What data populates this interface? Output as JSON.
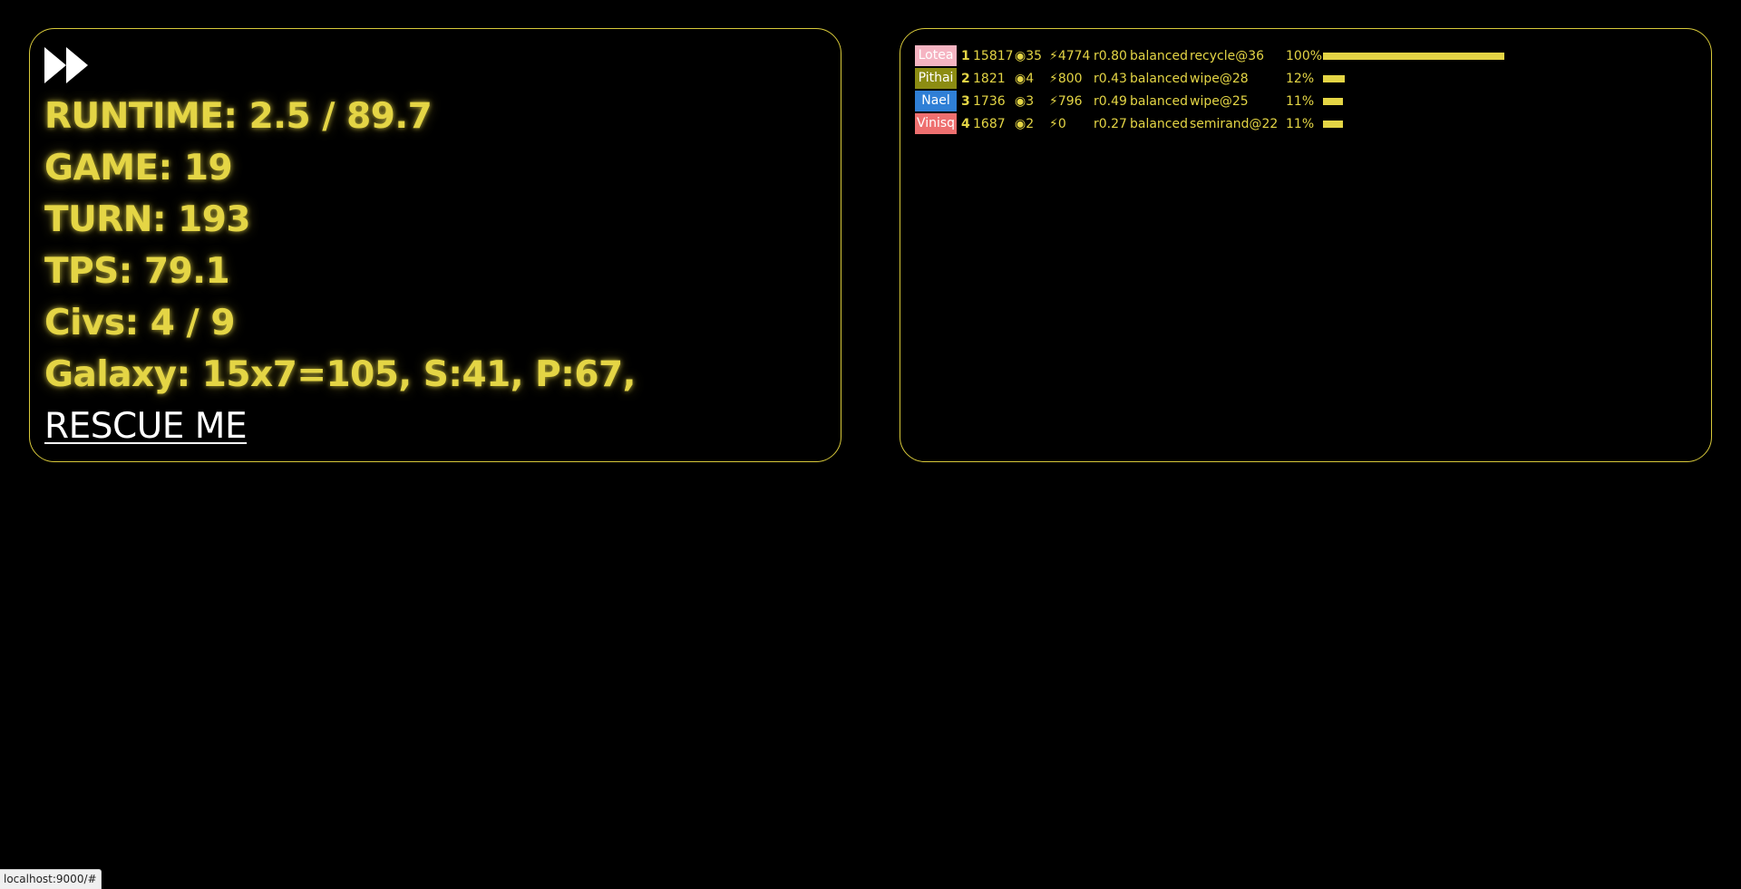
{
  "controls": {
    "fast_forward_icon": "fast-forward-icon"
  },
  "stats": {
    "runtime": "RUNTIME: 2.5 / 89.7",
    "game": "GAME: 19",
    "turn": "TURN: 193",
    "tps": "TPS: 79.1",
    "civs": "Civs: 4 / 9",
    "galaxy": "Galaxy: 15x7=105, S:41, P:67,",
    "rescue_label": "RESCUE ME"
  },
  "colors": {
    "accent": "#e4d545",
    "panel_border": "#d8c93a",
    "background": "#000000",
    "link": "#ffffff"
  },
  "rankings": [
    {
      "name": "Lotea",
      "color": "#f5b4c2",
      "rank": "1",
      "score": "15817",
      "planets": "◉35",
      "energy": "⚡4774",
      "ratio": "r0.80",
      "mode": "balanced",
      "strategy": "recycle@36",
      "percent_label": "100%",
      "percent": 1.0
    },
    {
      "name": "Pithai",
      "color": "#8c8c12",
      "rank": "2",
      "score": "1821",
      "planets": "◉4",
      "energy": "⚡800",
      "ratio": "r0.43",
      "mode": "balanced",
      "strategy": "wipe@28",
      "percent_label": "12%",
      "percent": 0.12
    },
    {
      "name": "Nael",
      "color": "#2f7fd6",
      "rank": "3",
      "score": "1736",
      "planets": "◉3",
      "energy": "⚡796",
      "ratio": "r0.49",
      "mode": "balanced",
      "strategy": "wipe@25",
      "percent_label": "11%",
      "percent": 0.11
    },
    {
      "name": "Vinisq",
      "color": "#ee6f6f",
      "rank": "4",
      "score": "1687",
      "planets": "◉2",
      "energy": "⚡0",
      "ratio": "r0.27",
      "mode": "balanced",
      "strategy": "semirand@22",
      "percent_label": "11%",
      "percent": 0.11
    }
  ],
  "status_bar": {
    "url": "localhost:9000/#"
  }
}
